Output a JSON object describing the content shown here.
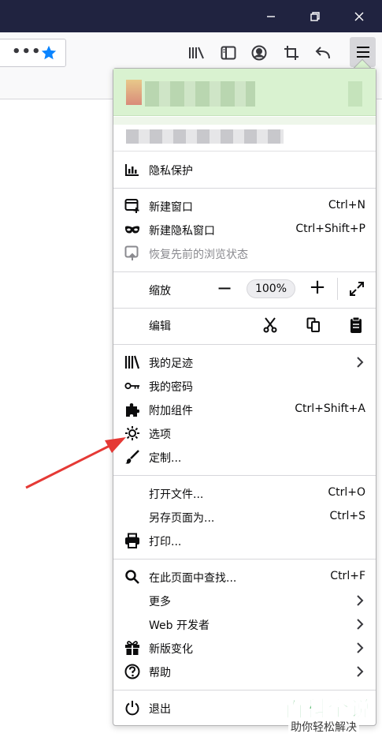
{
  "window_controls": {
    "minimize": "minimize-icon",
    "restore": "restore-icon",
    "close": "close-icon"
  },
  "toolbar": {
    "url_more_icon": "•••",
    "bookmark_icon": "star-icon",
    "icons": [
      "library-icon",
      "sidebar-icon",
      "account-icon",
      "screenshot-icon",
      "back-icon",
      "hamburger-menu-icon"
    ]
  },
  "menu": {
    "privacy": "隐私保护",
    "new_window": {
      "label": "新建窗口",
      "shortcut": "Ctrl+N"
    },
    "new_private_window": {
      "label": "新建隐私窗口",
      "shortcut": "Ctrl+Shift+P"
    },
    "restore_session": {
      "label": "恢复先前的浏览状态"
    },
    "zoom": {
      "label": "缩放",
      "minus": "−",
      "value": "100%",
      "plus": "+"
    },
    "edit": {
      "label": "编辑"
    },
    "library": {
      "label": "我的足迹"
    },
    "logins": {
      "label": "我的密码"
    },
    "addons": {
      "label": "附加组件",
      "shortcut": "Ctrl+Shift+A"
    },
    "options": {
      "label": "选项"
    },
    "customize": {
      "label": "定制..."
    },
    "open_file": {
      "label": "打开文件...",
      "shortcut": "Ctrl+O"
    },
    "save_page": {
      "label": "另存页面为...",
      "shortcut": "Ctrl+S"
    },
    "print": {
      "label": "打印..."
    },
    "find": {
      "label": "在此页面中查找...",
      "shortcut": "Ctrl+F"
    },
    "more": {
      "label": "更多"
    },
    "web_developer": {
      "label": "Web 开发者"
    },
    "whats_new": {
      "label": "新版变化"
    },
    "help": {
      "label": "帮助"
    },
    "exit": {
      "label": "退出"
    }
  },
  "watermark": {
    "title": "百科全说",
    "subtitle": "助你轻松解决"
  },
  "colors": {
    "titlebar": "#202340",
    "account_highlight": "#d9f2d0",
    "annotation_arrow": "#e53935",
    "watermark_green": "#2aa84a"
  }
}
